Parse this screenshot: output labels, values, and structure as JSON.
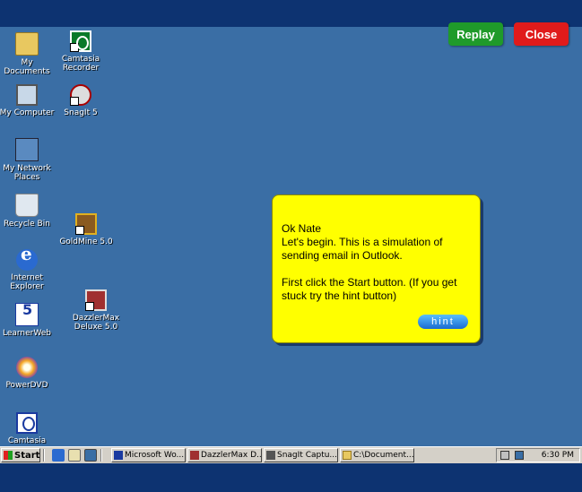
{
  "top_buttons": {
    "replay": "Replay",
    "close": "Close"
  },
  "desktop_icons": [
    {
      "label": "My Documents",
      "icon": "folder-documents-icon"
    },
    {
      "label": "Camtasia Recorder",
      "icon": "camtasia-recorder-icon"
    },
    {
      "label": "My Computer",
      "icon": "computer-icon"
    },
    {
      "label": "SnagIt 5",
      "icon": "snagit-icon"
    },
    {
      "label": "My Network Places",
      "icon": "network-places-icon"
    },
    {
      "label": "Recycle Bin",
      "icon": "recycle-bin-icon"
    },
    {
      "label": "GoldMine 5.0",
      "icon": "goldmine-icon"
    },
    {
      "label": "Internet Explorer",
      "icon": "internet-explorer-icon"
    },
    {
      "label": "LearnerWeb",
      "icon": "learnerweb-icon"
    },
    {
      "label": "DazzlerMax Deluxe 5.0",
      "icon": "dazzlermax-icon"
    },
    {
      "label": "PowerDVD",
      "icon": "powerdvd-icon"
    },
    {
      "label": "Camtasia",
      "icon": "camtasia-icon"
    }
  ],
  "dialog": {
    "greeting": "Ok  Nate",
    "line1": "Let's begin. This is a simulation of sending email in Outlook.",
    "line2": "First click the Start button. (If you get stuck try the hint button)",
    "hint_button": "hint"
  },
  "taskbar": {
    "start_label": "Start",
    "tasks": [
      {
        "label": "Microsoft Wo...",
        "icon": "word-icon"
      },
      {
        "label": "DazzlerMax D...",
        "icon": "dazzlermax-icon"
      },
      {
        "label": "SnagIt Captu...",
        "icon": "snagit-icon"
      },
      {
        "label": "C:\\Document...",
        "icon": "folder-icon"
      }
    ],
    "clock": "6:30 PM"
  },
  "colors": {
    "desktop": "#3a6ea5",
    "frame": "#0d3371",
    "replay": "#1f9a2a",
    "close": "#e01b1b",
    "dialog": "#ffff00"
  }
}
